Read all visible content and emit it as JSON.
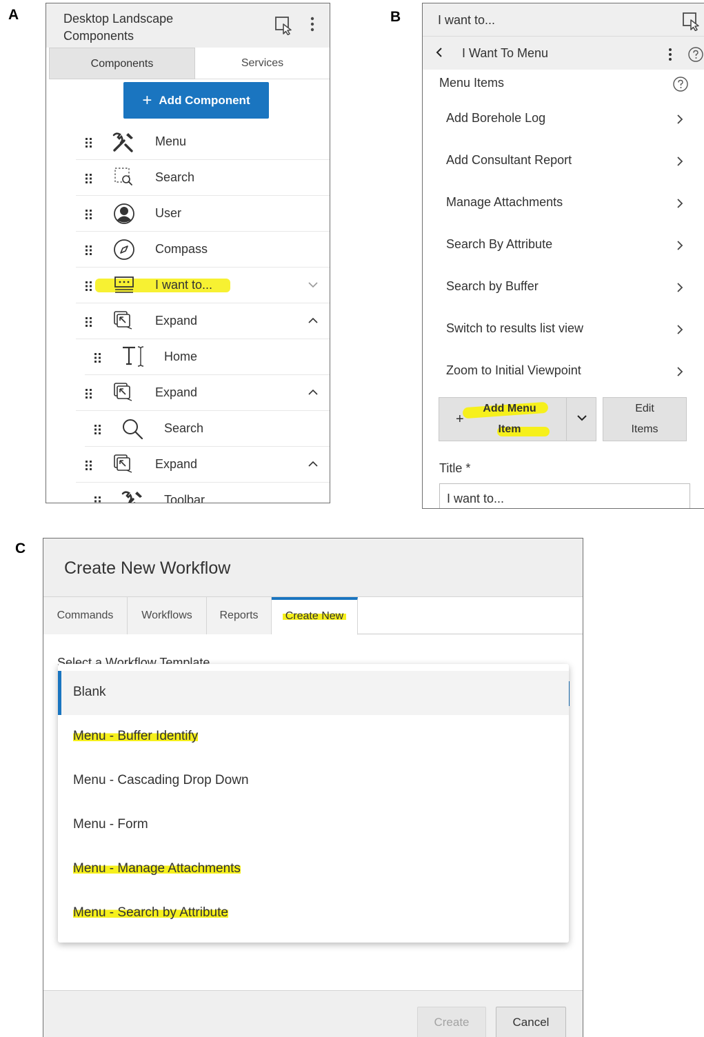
{
  "figure_labels": {
    "a": "A",
    "b": "B",
    "c": "C"
  },
  "colors": {
    "accent": "#1a75c0",
    "highlight": "#f6f01c",
    "header_bg": "#efefef"
  },
  "panel_a": {
    "title": "Desktop Landscape Components",
    "tabs": [
      "Components",
      "Services"
    ],
    "add_button_label": "Add Component",
    "rows": [
      {
        "label": "Menu",
        "icon": "tools-icon",
        "highlighted": false,
        "chevron": "none"
      },
      {
        "label": "Search",
        "icon": "search-region-icon",
        "highlighted": false,
        "chevron": "none"
      },
      {
        "label": "User",
        "icon": "user-icon",
        "highlighted": false,
        "chevron": "none"
      },
      {
        "label": "Compass",
        "icon": "compass-icon",
        "highlighted": false,
        "chevron": "none"
      },
      {
        "label": "I want to...",
        "icon": "i-want-to-icon",
        "highlighted": true,
        "chevron": "down"
      },
      {
        "label": "Expand",
        "icon": "expand-icon",
        "highlighted": false,
        "chevron": "up"
      },
      {
        "label": "Home",
        "icon": "text-icon",
        "highlighted": false,
        "chevron": "none"
      },
      {
        "label": "Expand",
        "icon": "expand-icon",
        "highlighted": false,
        "chevron": "up"
      },
      {
        "label": "Search",
        "icon": "search-icon",
        "highlighted": false,
        "chevron": "none"
      },
      {
        "label": "Expand",
        "icon": "expand-icon",
        "highlighted": false,
        "chevron": "up"
      },
      {
        "label": "Toolbar",
        "icon": "tools-icon",
        "highlighted": false,
        "chevron": "none"
      }
    ]
  },
  "panel_b": {
    "title": "I want to...",
    "subheader_title": "I Want To Menu",
    "menu_items_label": "Menu Items",
    "items": [
      "Add Borehole Log",
      "Add Consultant Report",
      "Manage Attachments",
      "Search By Attribute",
      "Search by Buffer",
      "Switch to results list view",
      "Zoom to Initial Viewpoint"
    ],
    "add_button_line1": "Add Menu",
    "add_button_line2": "Item",
    "add_button_plus": "+",
    "edit_button_line1": "Edit",
    "edit_button_line2": "Items",
    "title_field_label": "Title *",
    "title_field_value": "I want to..."
  },
  "panel_c": {
    "title": "Create New Workflow",
    "tabs": [
      "Commands",
      "Workflows",
      "Reports",
      "Create New"
    ],
    "active_tab": "Create New",
    "select_label": "Select a Workflow Template",
    "options": [
      {
        "label": "Blank",
        "selected": true,
        "highlighted": false
      },
      {
        "label": "Menu - Buffer Identify",
        "selected": false,
        "highlighted": true
      },
      {
        "label": "Menu - Cascading Drop Down",
        "selected": false,
        "highlighted": false
      },
      {
        "label": "Menu - Form",
        "selected": false,
        "highlighted": false
      },
      {
        "label": "Menu - Manage Attachments",
        "selected": false,
        "highlighted": true
      },
      {
        "label": "Menu - Search by Attribute",
        "selected": false,
        "highlighted": true
      }
    ],
    "create_button": "Create",
    "cancel_button": "Cancel"
  }
}
